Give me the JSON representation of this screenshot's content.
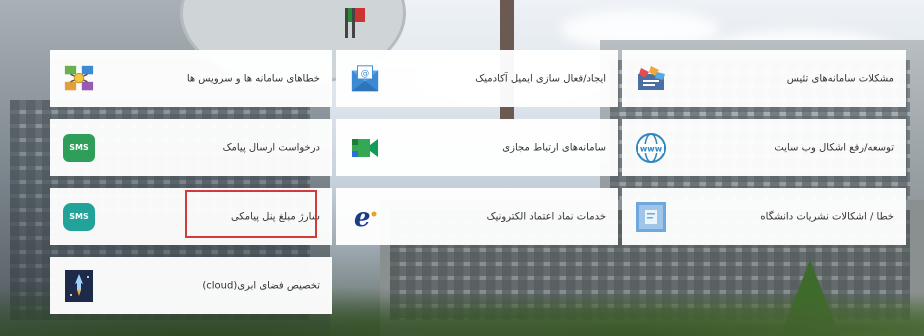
{
  "tiles": {
    "r1c1": {
      "label": "مشکلات سامانه‌های تئیس",
      "icon": "scattered-documents-icon"
    },
    "r1c2": {
      "label": "ایجاد/فعال سازی ایمیل آکادمیک",
      "icon": "email-envelope-icon"
    },
    "r1c3": {
      "label": "خطاهای سامانه ها و سرویس ها",
      "icon": "network-error-icon"
    },
    "r2c1": {
      "label": "توسعه/رفع اشکال وب سایت",
      "icon": "www-globe-icon"
    },
    "r2c2": {
      "label": "سامانه‌های ارتباط مجازی",
      "icon": "video-meet-icon"
    },
    "r2c3": {
      "label": "درخواست ارسال پیامک",
      "icon": "sms-icon",
      "badge": "SMS"
    },
    "r3c1": {
      "label": "خطا / اشکالات نشریات دانشگاه",
      "icon": "journal-icon"
    },
    "r3c2": {
      "label": "خدمات نماد اعتماد الکترونیک",
      "icon": "e-trust-icon"
    },
    "r3c3": {
      "label": "شارژ مبلغ پنل پیامکی",
      "icon": "sms-chat-icon",
      "badge": "SMS"
    },
    "r4c3": {
      "label": "تخصیص فضای ابری(cloud)",
      "icon": "cloud-rocket-icon"
    }
  },
  "colors": {
    "highlight": "#d23b3b",
    "sms_green": "#2f9e5b",
    "sms_teal": "#22a39a",
    "tile_bg": "#ffffff"
  }
}
